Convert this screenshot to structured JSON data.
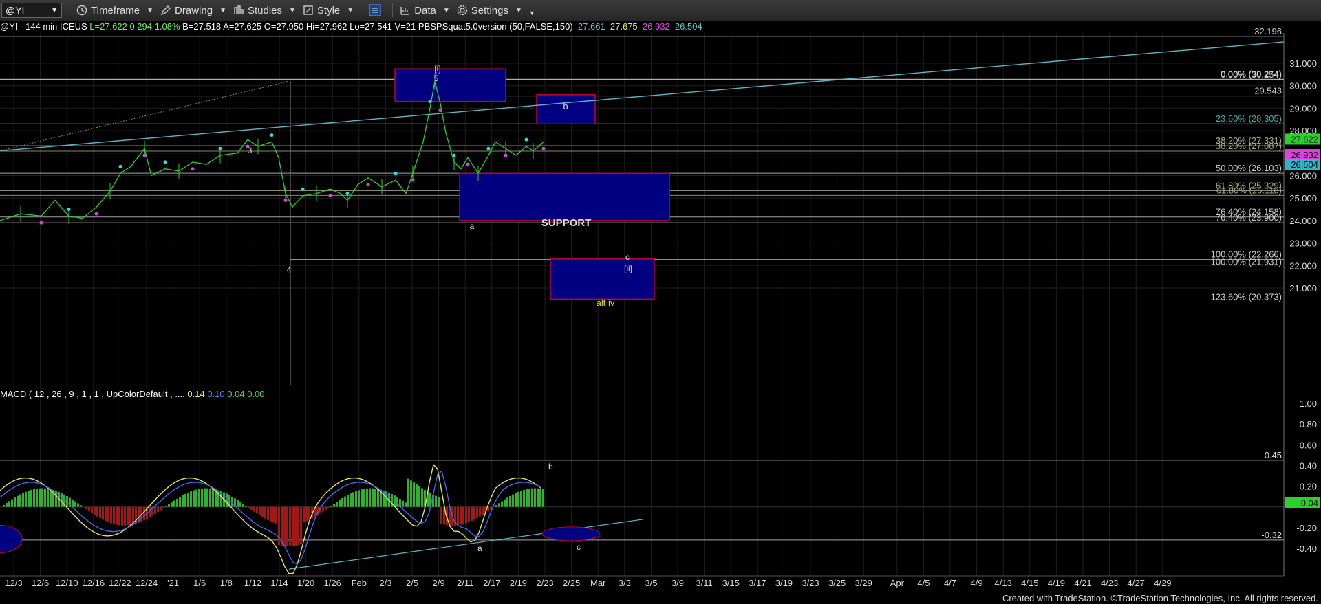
{
  "toolbar": {
    "symbol": "@YI",
    "timeframe": "Timeframe",
    "drawing": "Drawing",
    "studies": "Studies",
    "style": "Style",
    "data": "Data",
    "settings": "Settings"
  },
  "info": {
    "title": "@YI - 144 min  ICEUS",
    "last": "L=27.622",
    "chg": "0.294",
    "pct": "1.08%",
    "bid": "B=27.518",
    "ask": "A=27.625",
    "open": "O=27.950",
    "high": "Hi=27.962",
    "low": "Lo=27.541",
    "vol": "V=21",
    "study": "PBSPSquat5.0version (50,FALSE,150)",
    "sv1": "27.661",
    "sv2": "27.675",
    "sv3": "26.932",
    "sv4": "26.504"
  },
  "macd": {
    "label": "MACD ( 12 , 26 , 9 , 1 , 1 , UpColorDefault , ....",
    "v1": "0.14",
    "v2": "0.10",
    "v3": "0.04",
    "v4": "0.00"
  },
  "colors": {
    "bg": "#000000",
    "grid": "#1e1e1e",
    "box": "#000080",
    "boxBorder": "#c0003c",
    "trend": "#5bb8c8",
    "price": "#2bd12b",
    "macdFast": "#3a6cf0",
    "macdSlow": "#e8e85a"
  },
  "chart_data": {
    "type": "line",
    "price_axis": {
      "ticks": [
        "32.196",
        "31.000",
        "30.000",
        "29.543",
        "29.000",
        "28.000",
        "27.622",
        "26.932",
        "26.504",
        "26.000",
        "25.000",
        "24.000",
        "23.000",
        "22.000",
        "21.000"
      ],
      "scale_ticks": [
        31,
        30,
        29,
        28,
        27,
        26,
        25,
        24,
        23,
        22,
        21
      ],
      "scale_labels": [
        "31.000",
        "30.000",
        "29.000",
        "28.000",
        "27.000",
        "26.000",
        "25.000",
        "24.000",
        "23.000",
        "22.000",
        "21.000"
      ],
      "last_price": "27.622",
      "tag_pink": "26.932",
      "tag_cyan": "26.504"
    },
    "macd_axis": {
      "labels": [
        "1.00",
        "0.80",
        "0.60",
        "0.40",
        "0.20",
        "-0.20",
        "-0.40"
      ],
      "values": [
        1.0,
        0.8,
        0.6,
        0.4,
        0.2,
        -0.2,
        -0.4
      ],
      "current": "0.04"
    },
    "x_labels": [
      "12/3",
      "12/6",
      "12/10",
      "12/16",
      "12/22",
      "12/24",
      "'21",
      "1/6",
      "1/8",
      "1/12",
      "1/14",
      "1/20",
      "1/26",
      "Feb",
      "2/3",
      "2/5",
      "2/9",
      "2/11",
      "2/17",
      "2/19",
      "2/23",
      "2/25",
      "Mar",
      "3/3",
      "3/5",
      "3/9",
      "3/11",
      "3/15",
      "3/17",
      "3/19",
      "3/23",
      "3/25",
      "3/29",
      "Apr",
      "4/5",
      "4/7",
      "4/9",
      "4/13",
      "4/15",
      "4/19",
      "4/21",
      "4/23",
      "4/27",
      "4/29"
    ],
    "levels": [
      {
        "label": "32.196",
        "value": 32.196
      },
      {
        "label": "0.00% (30.254)",
        "value": 30.27
      },
      {
        "label": "0.00% (30.274)",
        "value": 30.29
      },
      {
        "label": "29.543",
        "value": 29.543
      },
      {
        "label": "23.60% (28.305)",
        "value": 28.305
      },
      {
        "label": "38.20% (27.331)",
        "value": 27.331
      },
      {
        "label": "38.20% (27.087)",
        "value": 27.087
      },
      {
        "label": "50.00% (26.103)",
        "value": 26.103
      },
      {
        "label": "61.80% (25.329)",
        "value": 25.329
      },
      {
        "label": "61.80% (25.118)",
        "value": 25.118
      },
      {
        "label": "76.40% (24.158)",
        "value": 24.158
      },
      {
        "label": "76.40% (23.900)",
        "value": 23.9
      },
      {
        "label": "100.00% (22.266)",
        "value": 22.266
      },
      {
        "label": "100.00% (21.931)",
        "value": 21.931
      },
      {
        "label": "123.60% (20.373)",
        "value": 20.373
      }
    ],
    "boxes": [
      {
        "label": "",
        "top": 30.75,
        "bottom": 29.3
      },
      {
        "label": "b",
        "top": 29.6,
        "bottom": 28.3
      },
      {
        "label": "SUPPORT",
        "top": 26.1,
        "bottom": 24.0
      },
      {
        "label": "alt iv",
        "top": 22.3,
        "bottom": 20.5
      }
    ],
    "wave_labels": [
      "[i]",
      "5",
      "3",
      "b",
      "a",
      "c",
      "[ii]",
      "4",
      "a",
      "b",
      "c"
    ],
    "macd_level_high": "0.45",
    "macd_level_low": "-0.32"
  },
  "credit": "Created with TradeStation. ©TradeStation Technologies, Inc. All rights reserved."
}
